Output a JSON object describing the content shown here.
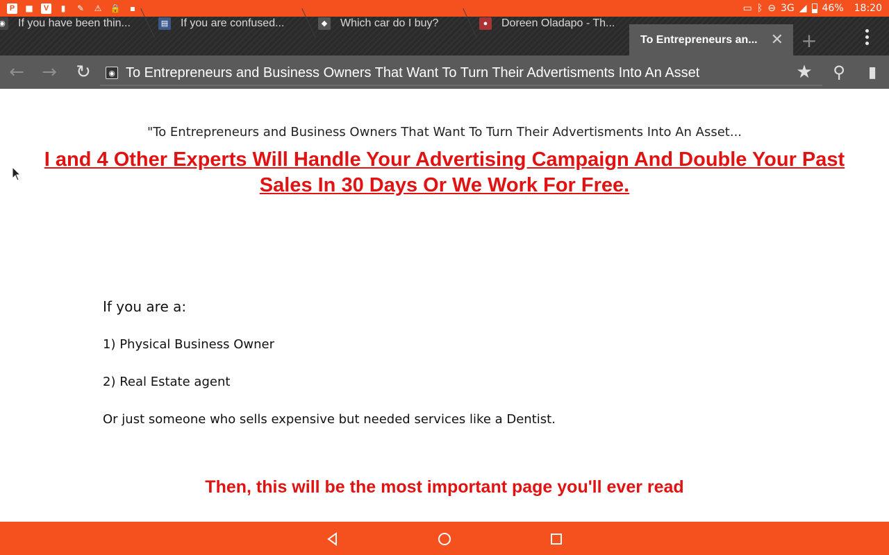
{
  "status_bar": {
    "network": "3G",
    "battery": "46%",
    "time": "18:20",
    "accent_color": "#f4511e"
  },
  "tabs": [
    {
      "title": "If you have been thin..."
    },
    {
      "title": "If you are confused..."
    },
    {
      "title": "Which car do I buy?"
    },
    {
      "title": "Doreen Oladapo - Th..."
    },
    {
      "title": "To Entrepreneurs an...",
      "active": true
    }
  ],
  "toolbar": {
    "address": "To Entrepreneurs and Business Owners That Want To Turn Their Advertisments Into An Asset"
  },
  "page": {
    "subhead": "\"To Entrepreneurs and Business Owners That Want To Turn Their Advertisments Into An Asset...",
    "headline": "I and 4 Other Experts Will Handle Your Advertising Campaign And Double Your Past Sales In 30 Days Or We Work For Free.",
    "intro": "If you are a:",
    "item1": "1) Physical Business Owner",
    "item2": "2) Real Estate agent",
    "item3": "Or just someone who sells expensive but needed services like a Dentist.",
    "cta": "Then, this will be the most important page you'll ever read",
    "headline_color": "#e01212"
  }
}
